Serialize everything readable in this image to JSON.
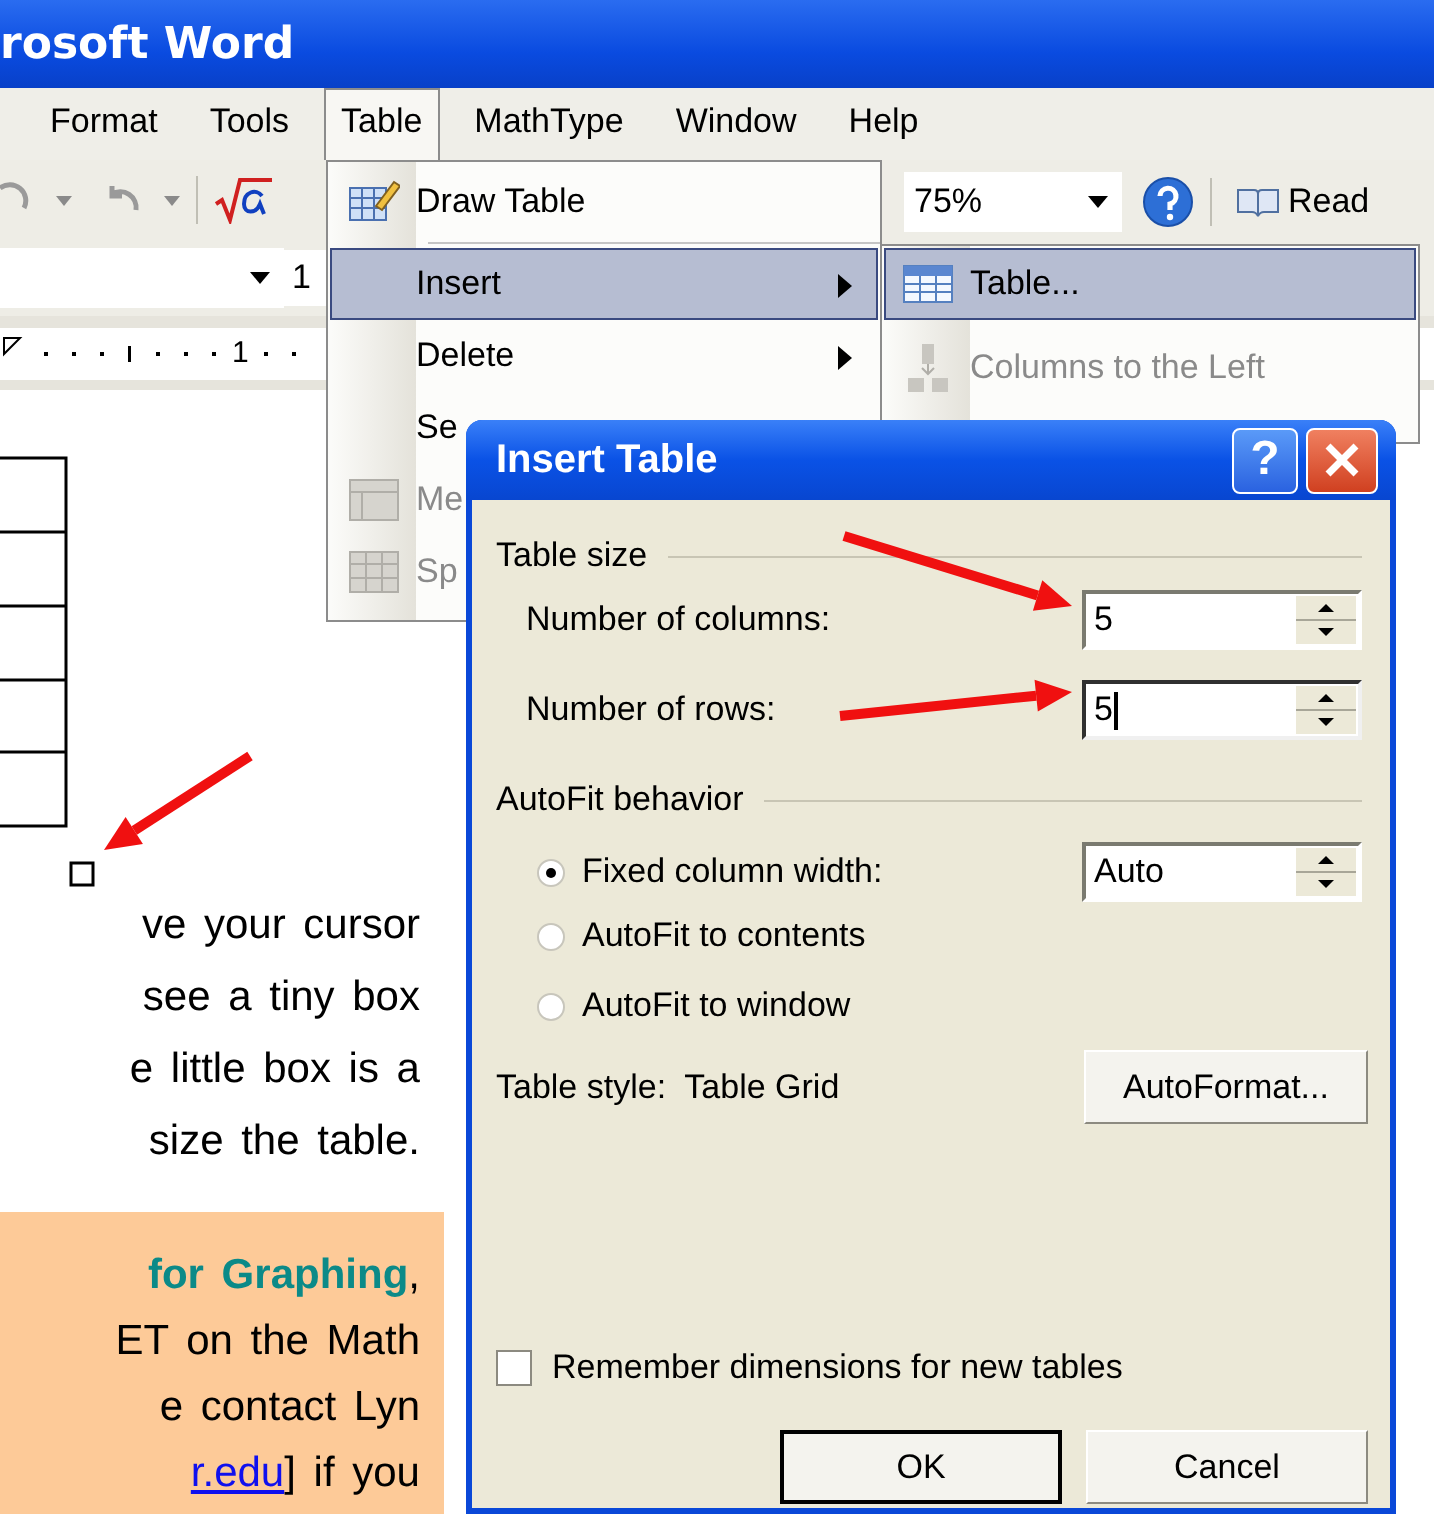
{
  "window": {
    "title": "rosoft Word"
  },
  "menu_bar": [
    {
      "label": "Format",
      "selected": false
    },
    {
      "label": "Tools",
      "selected": false
    },
    {
      "label": "Table",
      "selected": true
    },
    {
      "label": "MathType",
      "selected": false
    },
    {
      "label": "Window",
      "selected": false
    },
    {
      "label": "Help",
      "selected": false
    }
  ],
  "toolbar": {
    "zoom": "75%",
    "read_button": "Read"
  },
  "font_toolbar": {
    "font_size": "1"
  },
  "ruler": {
    "mark": "1"
  },
  "table_menu": [
    {
      "label": "Draw Table",
      "kind": "draw",
      "selected": false,
      "disabled": false,
      "has_submenu": false
    },
    {
      "label": "Insert",
      "kind": "plain",
      "selected": true,
      "disabled": false,
      "has_submenu": true
    },
    {
      "label": "Delete",
      "kind": "plain",
      "selected": false,
      "disabled": false,
      "has_submenu": true
    },
    {
      "label": "Se",
      "kind": "plain",
      "selected": false,
      "disabled": false,
      "has_submenu": false
    },
    {
      "label": "Me",
      "kind": "merge",
      "selected": false,
      "disabled": true,
      "has_submenu": false
    },
    {
      "label": "Sp",
      "kind": "split",
      "selected": false,
      "disabled": true,
      "has_submenu": false
    }
  ],
  "insert_submenu": [
    {
      "label": "Table...",
      "kind": "grid",
      "selected": true,
      "disabled": false
    },
    {
      "label": "Columns to the Left",
      "kind": "columns",
      "selected": false,
      "disabled": true
    }
  ],
  "document": {
    "paragraph": "ve your cursor\nsee a tiny box\ne little box is a\nsize the table.",
    "callout": {
      "text": "**for Graphing**,\nET on the Math\ne contact Lyn",
      "link": "r.edu",
      "after": "]  if  you"
    }
  },
  "dialog": {
    "title": "Insert Table",
    "help_button": "?",
    "table_size": {
      "label": "Table size",
      "fields": [
        {
          "label": "Number of columns:",
          "value": "5",
          "focused": false
        },
        {
          "label": "Number of rows:",
          "value": "5",
          "focused": true
        }
      ]
    },
    "autofit": {
      "label": "AutoFit behavior",
      "width": "Auto",
      "options": [
        {
          "label": "Fixed column width:",
          "selected": true
        },
        {
          "label": "AutoFit to contents",
          "selected": false
        },
        {
          "label": "AutoFit to window",
          "selected": false
        }
      ]
    },
    "table_style": "Table style:  Table Grid",
    "autoformat_button": "AutoFormat...",
    "remember": {
      "label": "Remember dimensions for new tables",
      "checked": false
    },
    "buttons": [
      {
        "label": "OK",
        "default": true
      },
      {
        "label": "Cancel",
        "default": false
      }
    ]
  }
}
